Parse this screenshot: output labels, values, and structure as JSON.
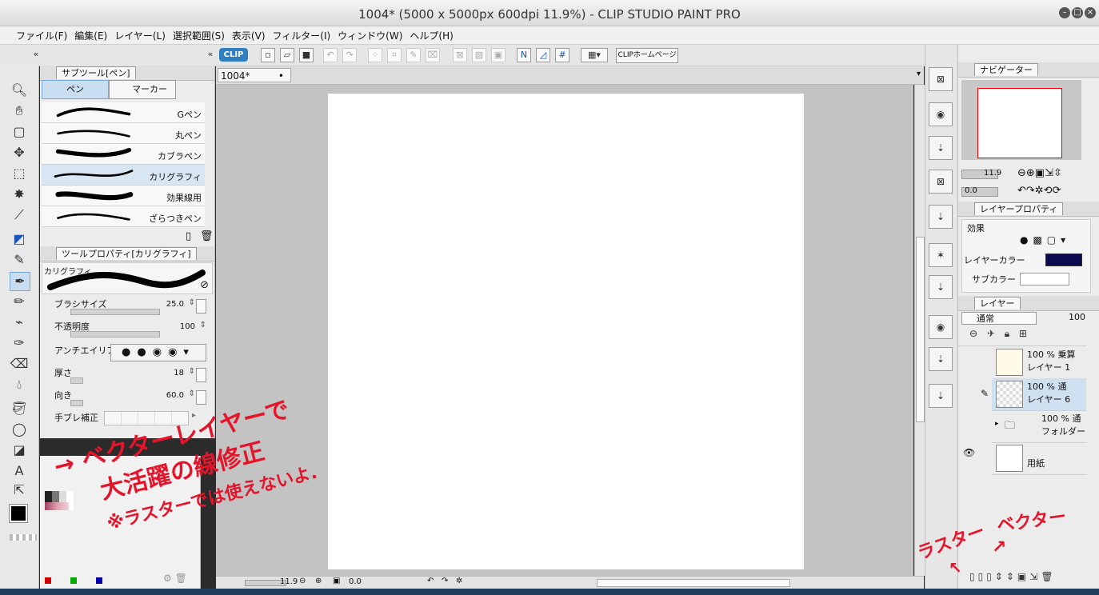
{
  "window": {
    "title": "1004* (5000 x 5000px 600dpi 11.9%)  - CLIP STUDIO PAINT PRO"
  },
  "menu": [
    "ファイル(F)",
    "編集(E)",
    "レイヤー(L)",
    "選択範囲(S)",
    "表示(V)",
    "フィルター(I)",
    "ウィンドウ(W)",
    "ヘルプ(H)"
  ],
  "toolbar": {
    "logo": "CLIP",
    "home_label": "CLIPホームページ"
  },
  "subtool": {
    "header": "サブツール[ペン]",
    "tabs": [
      "ペン",
      "マーカー"
    ],
    "brushes": [
      "Gペン",
      "丸ペン",
      "カブラペン",
      "カリグラフィ",
      "効果線用",
      "ざらつきペン"
    ],
    "selected_index": 3
  },
  "toolprop": {
    "header": "ツールプロパティ[カリグラフィ]",
    "preview_label": "カリグラフィ",
    "brush_size": {
      "label": "ブラシサイズ",
      "value": "25.0"
    },
    "opacity": {
      "label": "不透明度",
      "value": "100"
    },
    "antialias": {
      "label": "アンチエイリアス"
    },
    "thickness": {
      "label": "厚さ",
      "value": "18"
    },
    "direction": {
      "label": "向き",
      "value": "60.0"
    },
    "stabilization": {
      "label": "手ブレ補正"
    }
  },
  "document": {
    "tab_label": "1004*",
    "zoom": "11.9",
    "rotation": "0.0"
  },
  "navigator": {
    "tab": "ナビゲーター",
    "zoom": "11.9",
    "rotation": "0.0"
  },
  "layer_property": {
    "tab": "レイヤープロパティ",
    "effect_label": "効果",
    "layer_color": "レイヤーカラー",
    "sub_color": "サブカラー",
    "layer_color_hex": "#0a0a50"
  },
  "layers": {
    "tab": "レイヤー",
    "blend_mode": "通常",
    "opacity": "100",
    "rows": [
      {
        "mode": "100 % 乗算",
        "name": "レイヤー 1"
      },
      {
        "mode": "100 % 通",
        "name": "レイヤー 6"
      },
      {
        "mode": "100 % 通",
        "name": "フォルダー"
      },
      {
        "mode": "",
        "name": "用紙"
      }
    ]
  },
  "annotations": {
    "line1": "ベクターレイヤーで",
    "line2": "大活躍の線修正",
    "line3": "※ラスターでは使えないよ.",
    "raster": "ラスター",
    "vector": "ベクター"
  },
  "colors": {
    "accent": "#e4152a",
    "canvas_bg": "#c3c3c3"
  }
}
